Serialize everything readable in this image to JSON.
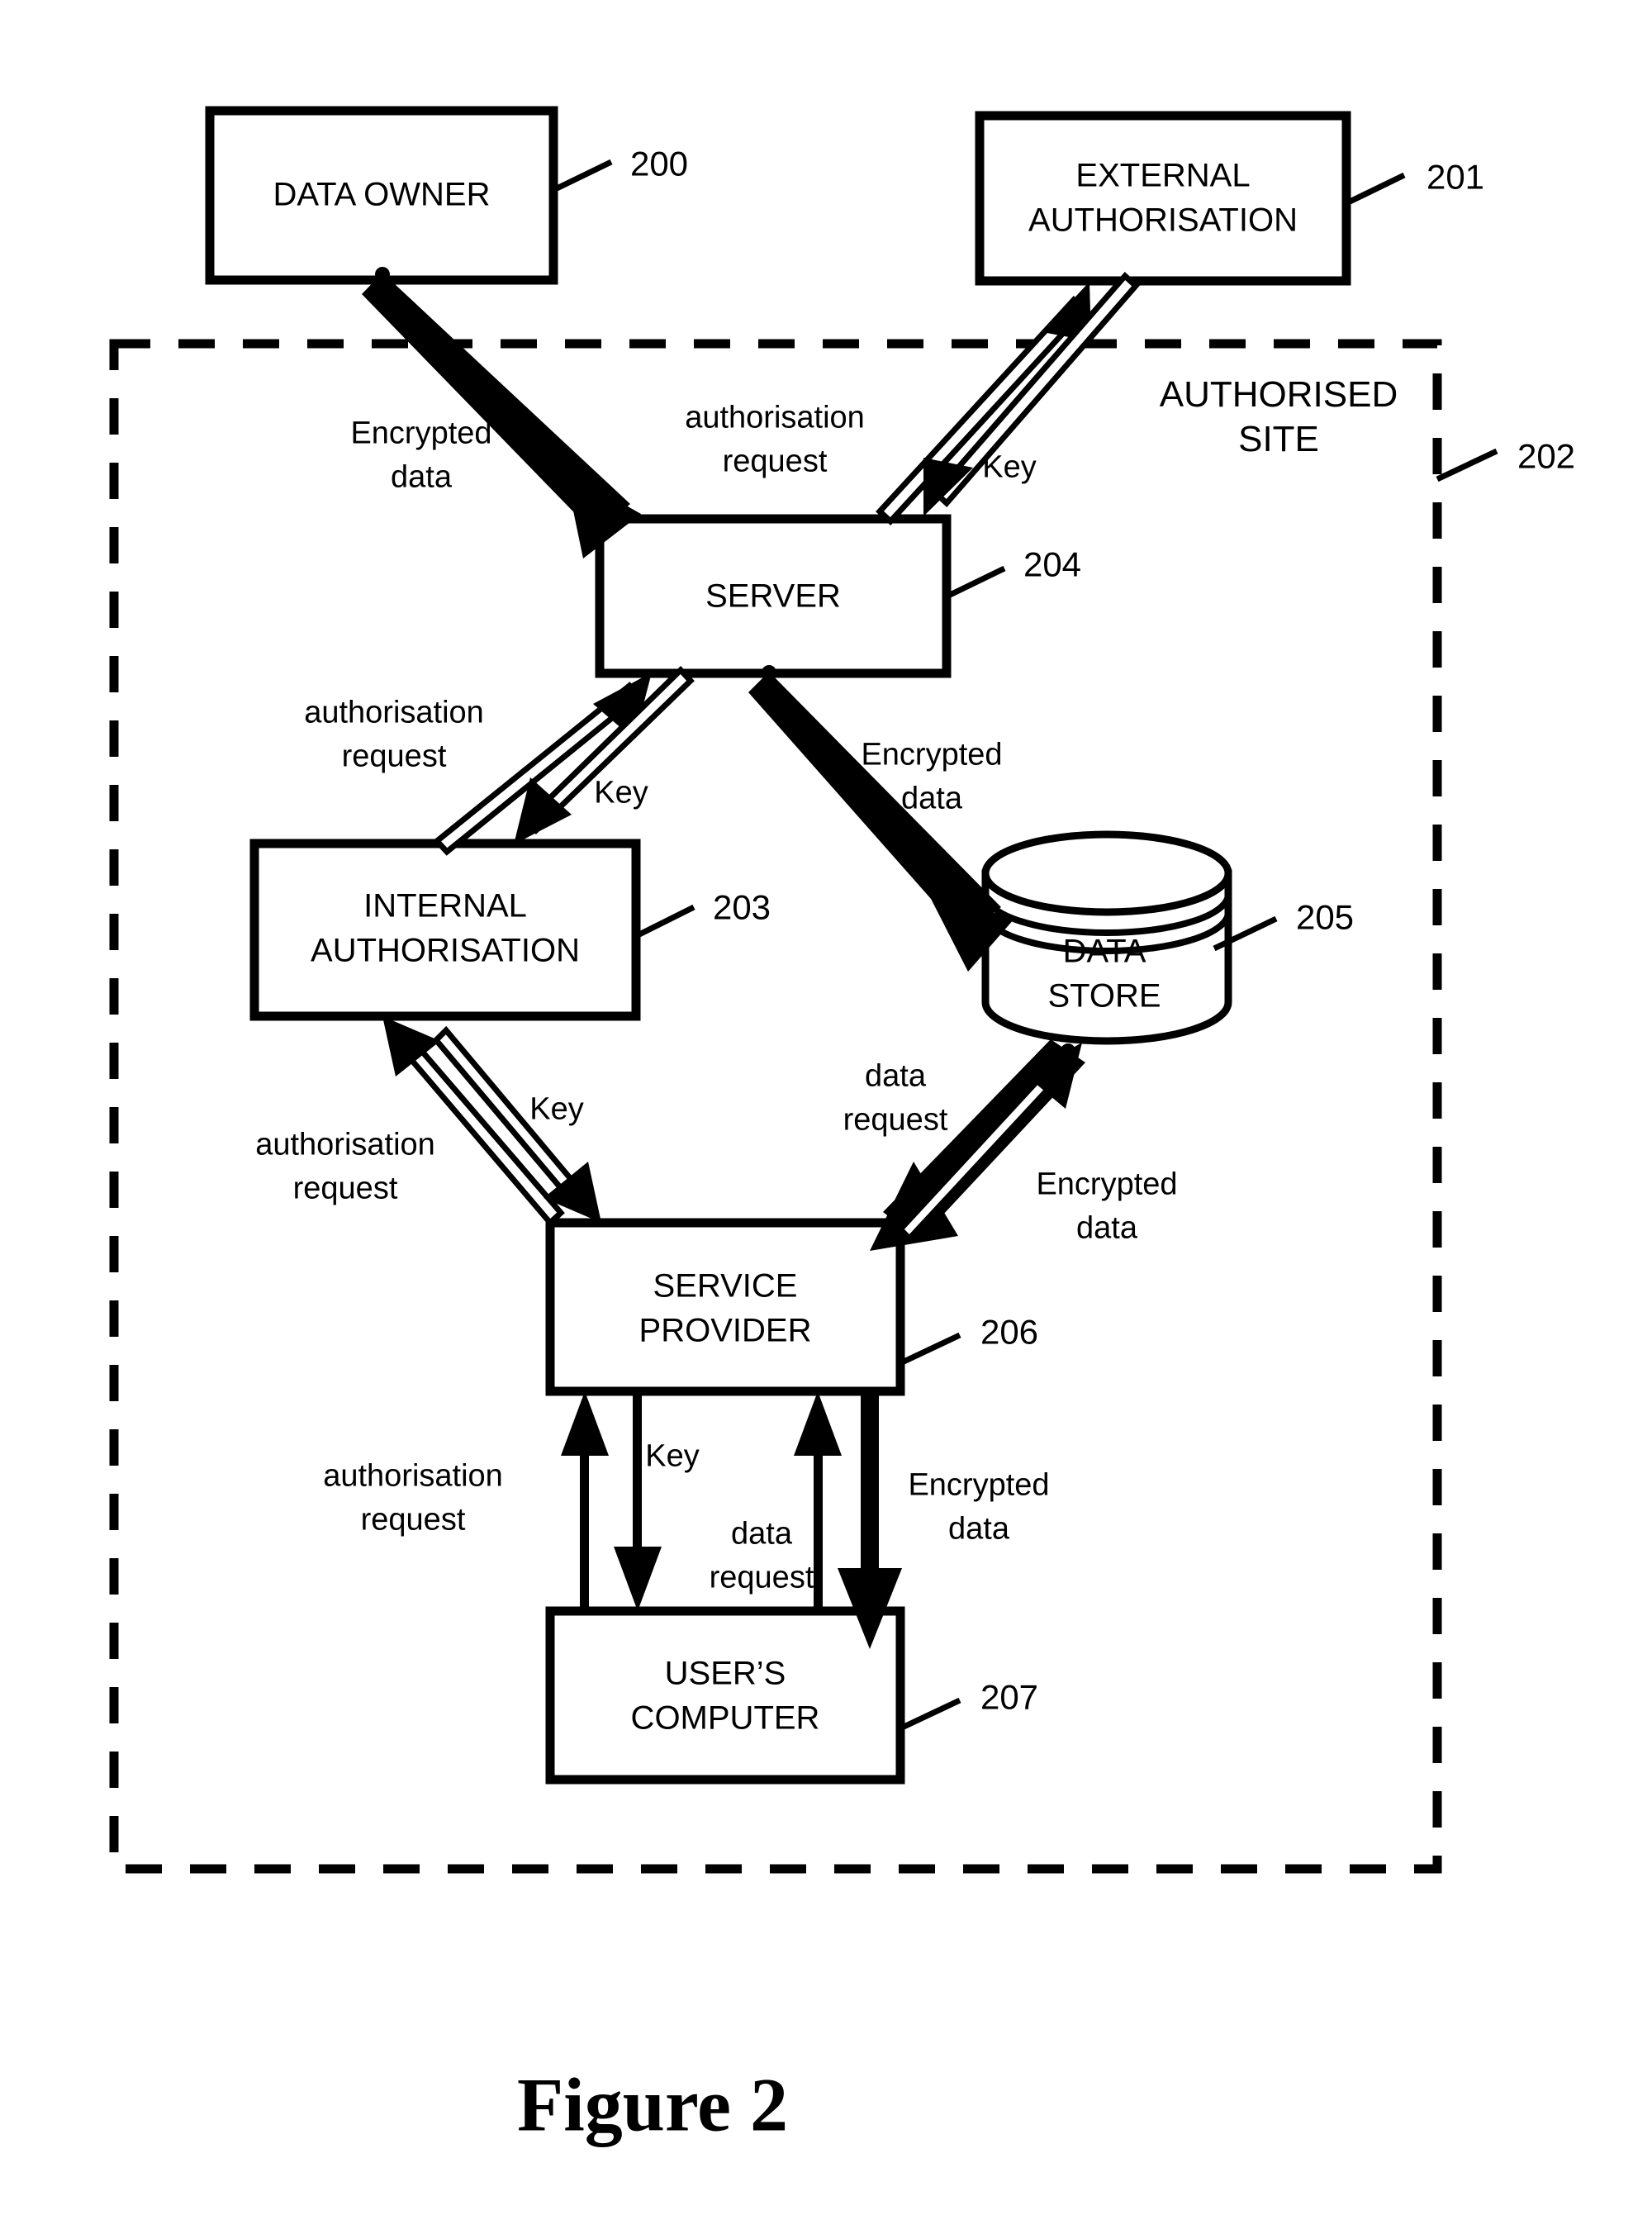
{
  "figure": {
    "caption": "Figure 2",
    "boundary_label": "AUTHORISED\nSITE",
    "boundary_ref": "202"
  },
  "nodes": [
    {
      "id": "data-owner",
      "label": "DATA OWNER",
      "ref": "200",
      "shape": "rect"
    },
    {
      "id": "external-authorisation",
      "label": "EXTERNAL\nAUTHORISATION",
      "ref": "201",
      "shape": "rect"
    },
    {
      "id": "server",
      "label": "SERVER",
      "ref": "204",
      "shape": "rect"
    },
    {
      "id": "internal-authorisation",
      "label": "INTERNAL\nAUTHORISATION",
      "ref": "203",
      "shape": "rect"
    },
    {
      "id": "data-store",
      "label": "DATA\nSTORE",
      "ref": "205",
      "shape": "cylinder"
    },
    {
      "id": "service-provider",
      "label": "SERVICE\nPROVIDER",
      "ref": "206",
      "shape": "rect"
    },
    {
      "id": "users-computer",
      "label": "USER’S\nCOMPUTER",
      "ref": "207",
      "shape": "rect"
    }
  ],
  "flows": [
    {
      "id": "do-server-encrypted",
      "label": "Encrypted\ndata",
      "from": "data-owner",
      "to": "server",
      "style": "thick"
    },
    {
      "id": "server-ext-authreq",
      "label": "authorisation\nrequest",
      "from": "server",
      "to": "external-authorisation",
      "style": "thin"
    },
    {
      "id": "ext-server-key",
      "label": "Key",
      "from": "external-authorisation",
      "to": "server",
      "style": "thin"
    },
    {
      "id": "server-int-authreq",
      "label": "authorisation\nrequest",
      "from": "server",
      "to": "internal-authorisation",
      "style": "thin"
    },
    {
      "id": "int-server-key",
      "label": "Key",
      "from": "internal-authorisation",
      "to": "server",
      "style": "thin"
    },
    {
      "id": "server-store-encrypted",
      "label": "Encrypted\ndata",
      "from": "server",
      "to": "data-store",
      "style": "thick"
    },
    {
      "id": "sp-int-authreq",
      "label": "authorisation\nrequest",
      "from": "service-provider",
      "to": "internal-authorisation",
      "style": "thin"
    },
    {
      "id": "int-sp-key",
      "label": "Key",
      "from": "internal-authorisation",
      "to": "service-provider",
      "style": "thin"
    },
    {
      "id": "sp-store-datareq",
      "label": "data\nrequest",
      "from": "service-provider",
      "to": "data-store",
      "style": "thin"
    },
    {
      "id": "store-sp-encrypted",
      "label": "Encrypted\ndata",
      "from": "data-store",
      "to": "service-provider",
      "style": "thick"
    },
    {
      "id": "user-sp-authreq",
      "label": "authorisation\nrequest",
      "from": "users-computer",
      "to": "service-provider",
      "style": "thin"
    },
    {
      "id": "sp-user-key",
      "label": "Key",
      "from": "service-provider",
      "to": "users-computer",
      "style": "thin"
    },
    {
      "id": "user-sp-datareq",
      "label": "data\nrequest",
      "from": "users-computer",
      "to": "service-provider",
      "style": "thin"
    },
    {
      "id": "sp-user-encrypted",
      "label": "Encrypted\ndata",
      "from": "service-provider",
      "to": "users-computer",
      "style": "thick"
    }
  ],
  "labels": {
    "data_owner": "DATA OWNER",
    "external_authorisation_l1": "EXTERNAL",
    "external_authorisation_l2": "AUTHORISATION",
    "server": "SERVER",
    "internal_authorisation_l1": "INTERNAL",
    "internal_authorisation_l2": "AUTHORISATION",
    "data_store_l1": "DATA",
    "data_store_l2": "STORE",
    "service_provider_l1": "SERVICE",
    "service_provider_l2": "PROVIDER",
    "users_computer_l1": "USER’S",
    "users_computer_l2": "COMPUTER",
    "authorised_site_l1": "AUTHORISED",
    "authorised_site_l2": "SITE",
    "encrypted_data_l1": "Encrypted",
    "encrypted_data_l2": "data",
    "authorisation_request_l1": "authorisation",
    "authorisation_request_l2": "request",
    "key": "Key",
    "data_request_l1": "data",
    "data_request_l2": "request",
    "figure_caption": "Figure 2"
  },
  "refs": {
    "data_owner": "200",
    "external_authorisation": "201",
    "authorised_site": "202",
    "internal_authorisation": "203",
    "server": "204",
    "data_store": "205",
    "service_provider": "206",
    "users_computer": "207"
  },
  "colors": {
    "stroke": "#000000",
    "background": "#ffffff"
  }
}
